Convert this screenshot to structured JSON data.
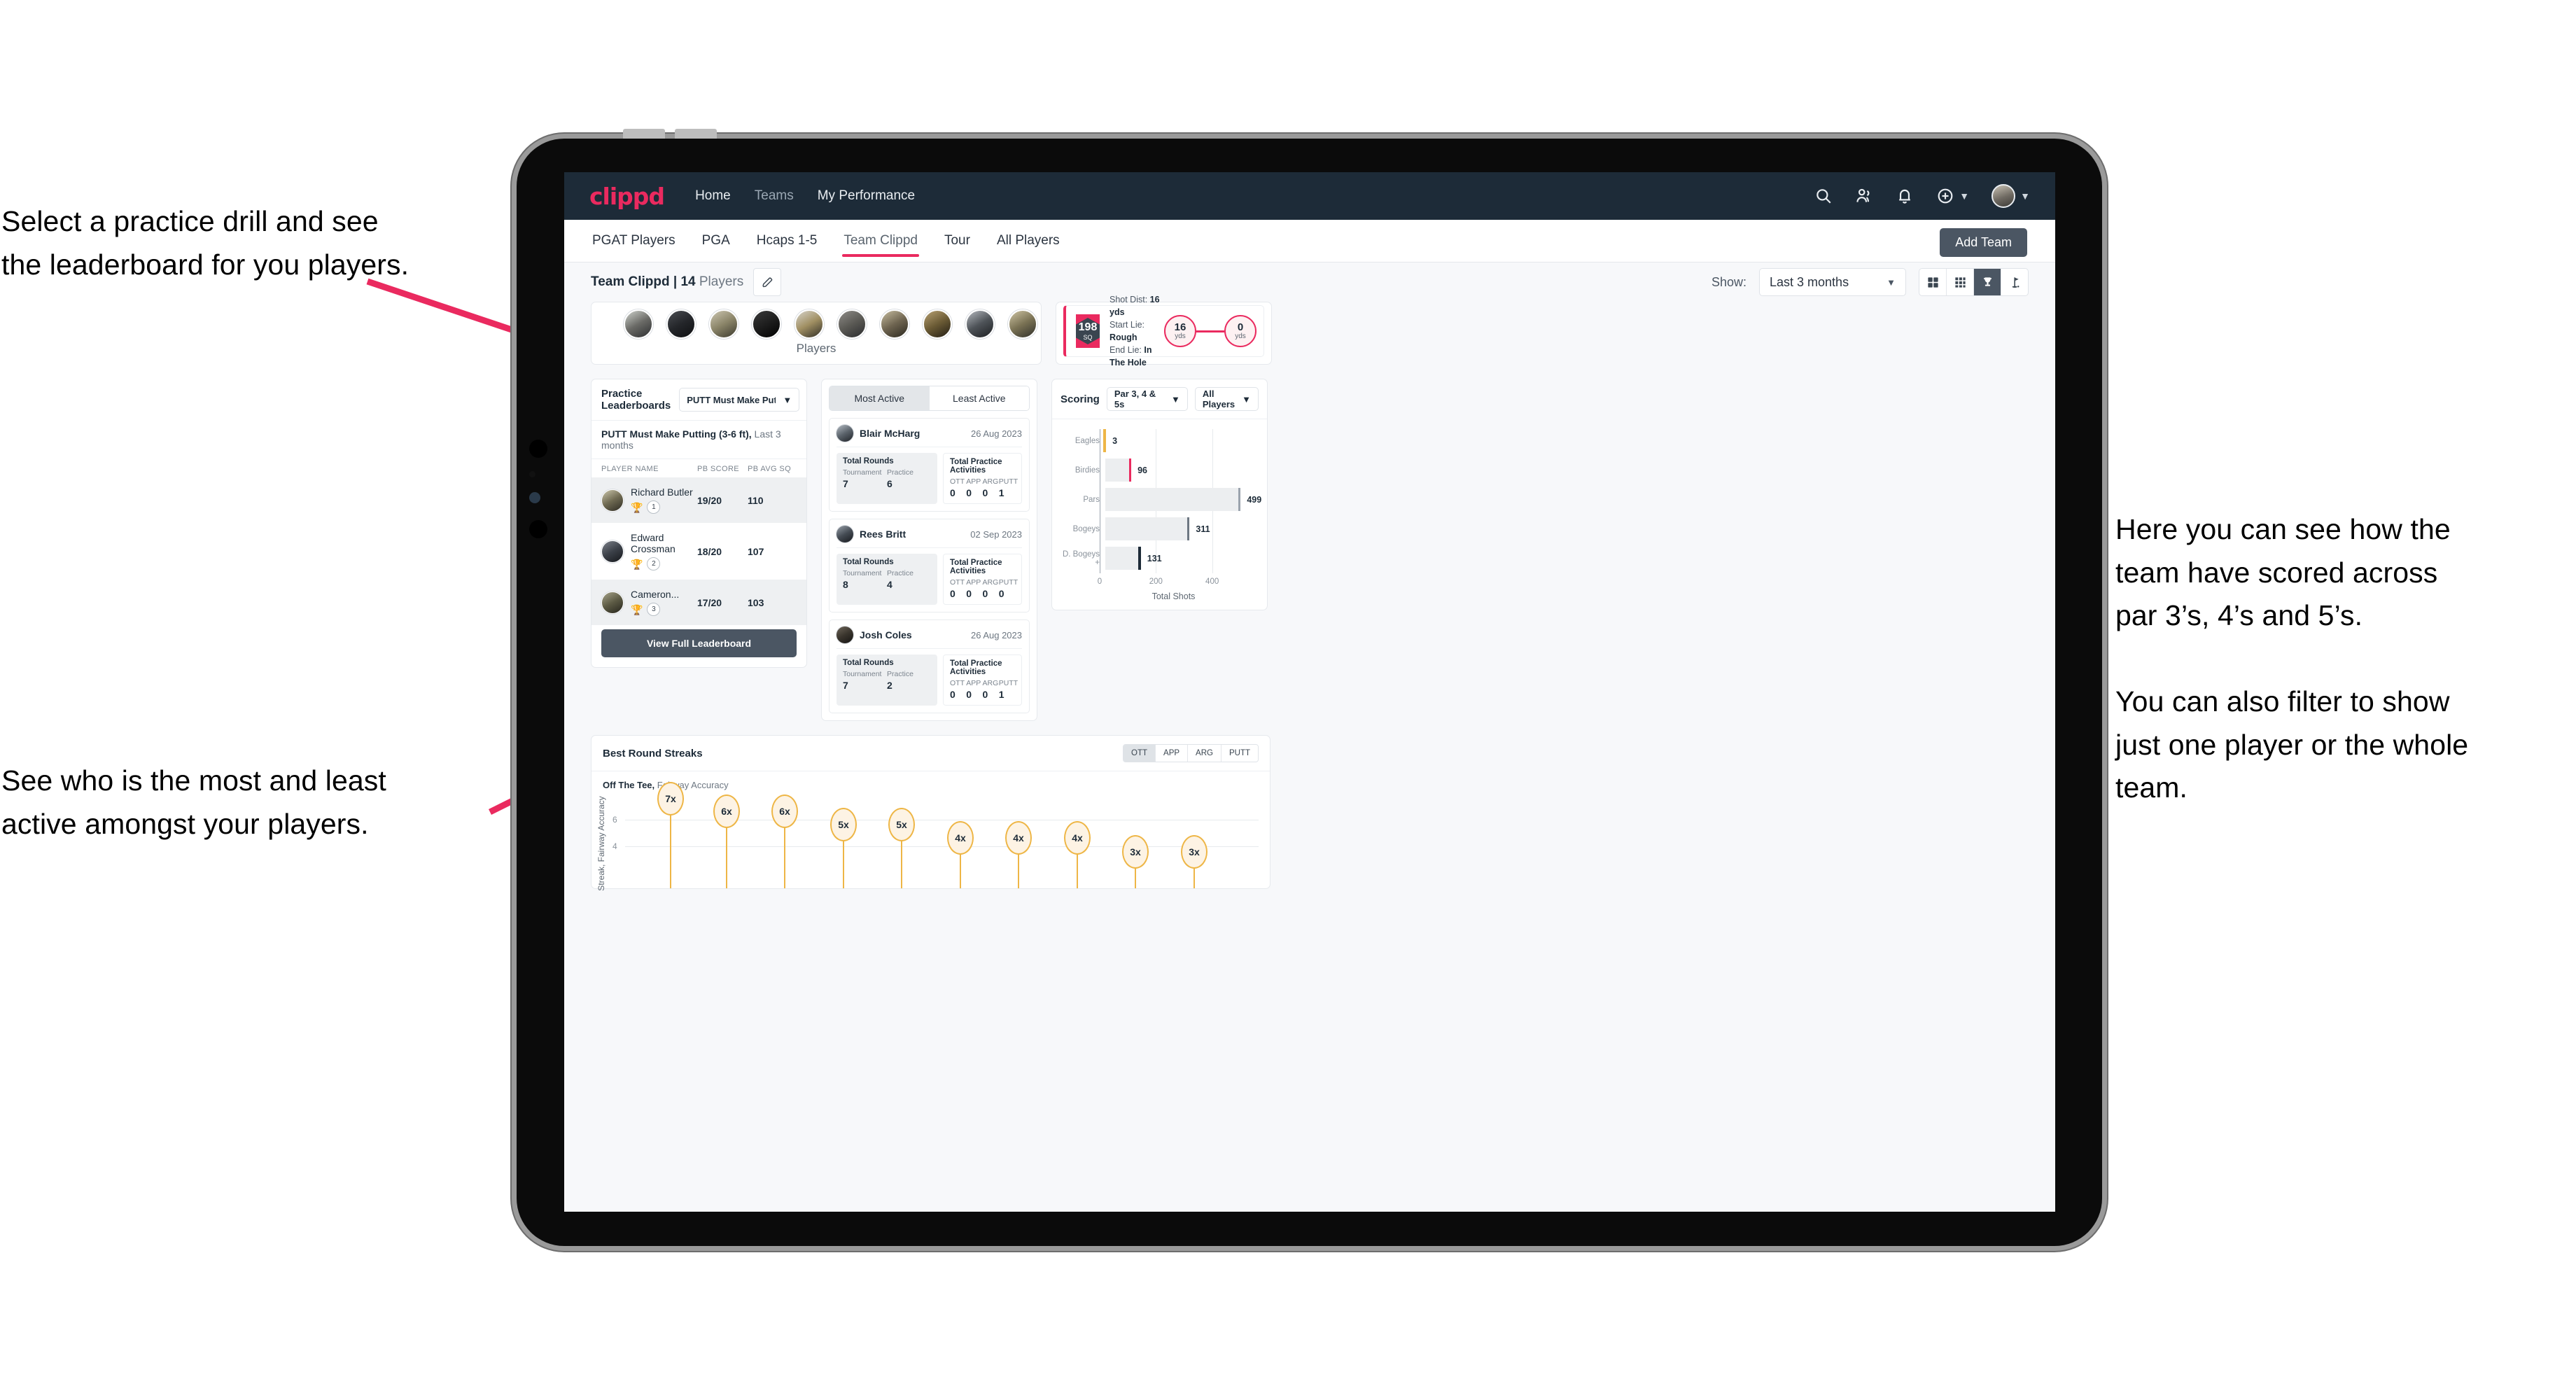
{
  "annotations": [
    {
      "id": "a1",
      "text": "Select a practice drill and see\nthe leaderboard for you players."
    },
    {
      "id": "a2",
      "text": "See who is the most and least\nactive amongst your players."
    },
    {
      "id": "a3",
      "text": "Here you can see how the\nteam have scored across\npar 3’s, 4’s and 5’s.\n\nYou can also filter to show\njust one player or the whole\nteam."
    }
  ],
  "navbar": {
    "logo": "clippd",
    "links": [
      {
        "label": "Home"
      },
      {
        "label": "Teams"
      },
      {
        "label": "My Performance"
      }
    ],
    "icons": [
      "search-icon",
      "people-icon",
      "bell-icon",
      "plus-circle-icon",
      "avatar"
    ]
  },
  "tabs": {
    "items": [
      "PGAT Players",
      "PGA",
      "Hcaps 1-5",
      "Team Clippd",
      "Tour",
      "All Players"
    ],
    "active": "Team Clippd",
    "add_team_label": "Add Team"
  },
  "subheader": {
    "team_label_bold": "Team Clippd | 14",
    "team_label_rest": " Players",
    "show_label": "Show:",
    "range_value": "Last 3 months",
    "view_icons": [
      "grid-large-icon",
      "grid-small-icon",
      "trophy-icon",
      "flag-icon"
    ],
    "active_view": "trophy-icon"
  },
  "players_card": {
    "caption": "Players",
    "count": 10
  },
  "shot_card": {
    "sq_value": "198",
    "sq_unit": "SQ",
    "lines": [
      {
        "label": "Shot Dist: ",
        "value": "16 yds"
      },
      {
        "label": "Start Lie: ",
        "value": "Rough"
      },
      {
        "label": "End Lie: ",
        "value": "In The Hole"
      }
    ],
    "start_dot": {
      "value": "16",
      "unit": "yds"
    },
    "end_dot": {
      "value": "0",
      "unit": "yds"
    }
  },
  "leaderboard": {
    "title": "Practice Leaderboards",
    "drill_select": "PUTT Must Make Putting ...",
    "subtitle_bold": "PUTT Must Make Putting (3-6 ft),",
    "subtitle_rest": " Last 3 months",
    "columns": [
      "PLAYER NAME",
      "PB SCORE",
      "PB AVG SQ"
    ],
    "rows": [
      {
        "name": "Richard Butler",
        "rank": "1",
        "trophy": "🏆",
        "trophy_color": "#e8b23a",
        "score": "19/20",
        "sq": "110"
      },
      {
        "name": "Edward Crossman",
        "rank": "2",
        "trophy": "🏆",
        "trophy_color": "#c3c8cd",
        "score": "18/20",
        "sq": "107"
      },
      {
        "name": "Cameron...",
        "rank": "3",
        "trophy": "🏆",
        "trophy_color": "#d08a3c",
        "score": "17/20",
        "sq": "103"
      }
    ],
    "button_label": "View Full Leaderboard"
  },
  "activity": {
    "tabs": [
      "Most Active",
      "Least Active"
    ],
    "active_tab": "Most Active",
    "rounds_header": "Total Rounds",
    "rounds_cols": [
      "Tournament",
      "Practice"
    ],
    "practice_header": "Total Practice Activities",
    "practice_cols": [
      "OTT",
      "APP",
      "ARG",
      "PUTT"
    ],
    "items": [
      {
        "name": "Blair McHarg",
        "date": "26 Aug 2023",
        "rounds": [
          "7",
          "6"
        ],
        "practice": [
          "0",
          "0",
          "0",
          "1"
        ]
      },
      {
        "name": "Rees Britt",
        "date": "02 Sep 2023",
        "rounds": [
          "8",
          "4"
        ],
        "practice": [
          "0",
          "0",
          "0",
          "0"
        ]
      },
      {
        "name": "Josh Coles",
        "date": "26 Aug 2023",
        "rounds": [
          "7",
          "2"
        ],
        "practice": [
          "0",
          "0",
          "0",
          "1"
        ]
      }
    ]
  },
  "scoring": {
    "title": "Scoring",
    "par_select": "Par 3, 4 & 5s",
    "player_select": "All Players"
  },
  "streaks": {
    "title": "Best Round Streaks",
    "seg": [
      "OTT",
      "APP",
      "ARG",
      "PUTT"
    ],
    "active_seg": "OTT",
    "sub_bold": "Off The Tee,",
    "sub_rest": " Fairway Accuracy"
  },
  "chart_data": [
    {
      "type": "bar",
      "orientation": "horizontal",
      "title": "Scoring",
      "categories": [
        "Eagles",
        "Birdies",
        "Pars",
        "Bogeys",
        "D. Bogeys +"
      ],
      "values": [
        3,
        96,
        499,
        311,
        131
      ],
      "cap_colors": [
        "#eeb646",
        "#ea2a5f",
        "#9aa3ad",
        "#6d7782",
        "#1d2b38"
      ],
      "xlabel": "Total Shots",
      "ylabel": "",
      "xticks": [
        0,
        200,
        400
      ],
      "xlim": [
        0,
        560
      ],
      "grid": true,
      "legend": "none"
    },
    {
      "type": "scatter",
      "subtype": "lollipop",
      "title": "Best Round Streaks",
      "subtitle": "Off The Tee, Fairway Accuracy",
      "ylabel": "Streak, Fairway Accuracy",
      "yticks": [
        4,
        6
      ],
      "ylim": [
        0,
        7.8
      ],
      "labels": [
        "7x",
        "6x",
        "6x",
        "5x",
        "5x",
        "4x",
        "4x",
        "4x",
        "3x",
        "3x"
      ],
      "values": [
        7,
        6,
        6,
        5,
        5,
        4,
        4,
        4,
        3,
        3
      ],
      "grid": true,
      "legend": "none"
    }
  ]
}
